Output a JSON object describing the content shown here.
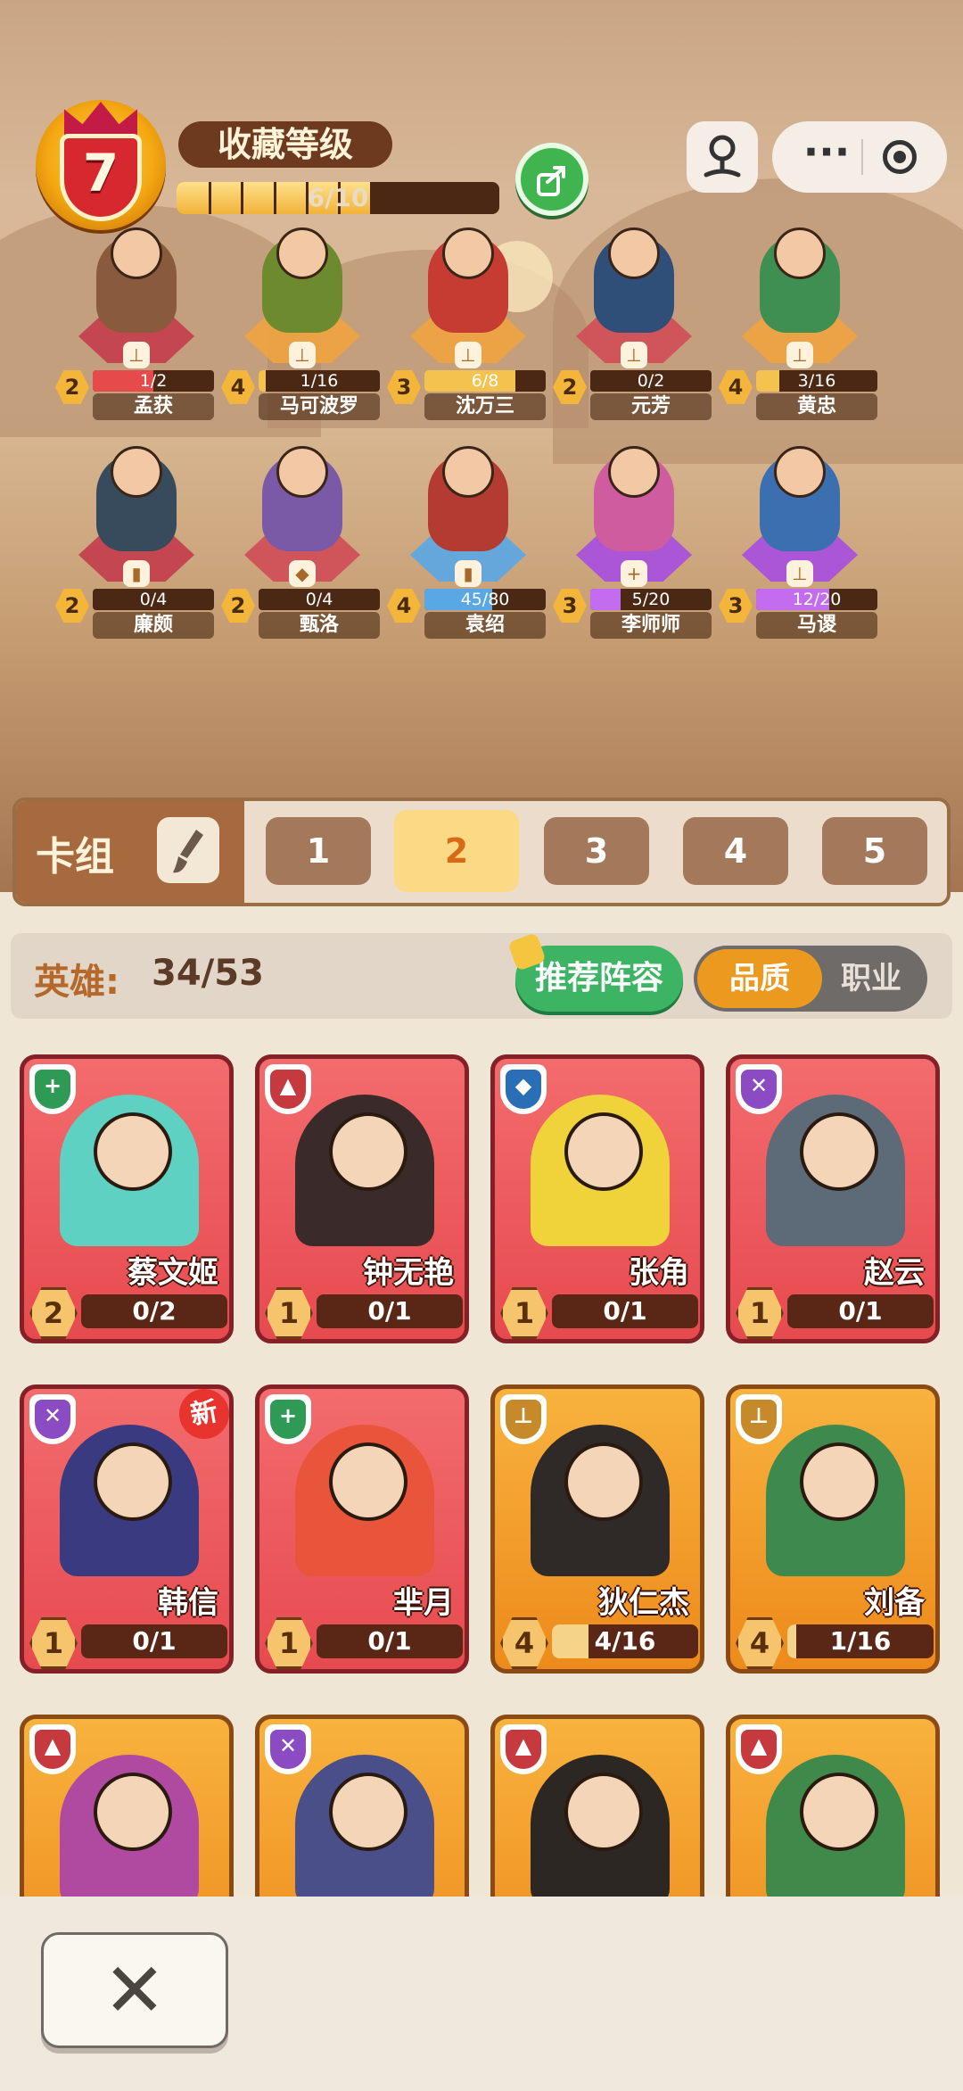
{
  "collection": {
    "level": "7",
    "title": "收藏等级",
    "progress_text": "6/10",
    "progress_fraction": 0.6
  },
  "roster": [
    {
      "name": "孟获",
      "level": "2",
      "progress": "1/2",
      "fraction": 0.5,
      "color": "#8a5a3c",
      "pedestal": "#c33c4d",
      "bar": "#e74a4a",
      "class_icon": "bow-icon"
    },
    {
      "name": "马可波罗",
      "level": "4",
      "progress": "1/16",
      "fraction": 0.06,
      "color": "#6d8a2e",
      "pedestal": "#f0a340",
      "bar": "#f4c24f",
      "class_icon": "bow-icon"
    },
    {
      "name": "沈万三",
      "level": "3",
      "progress": "6/8",
      "fraction": 0.75,
      "color": "#c63c32",
      "pedestal": "#f0a340",
      "bar": "#f4c24f",
      "class_icon": "bow-icon"
    },
    {
      "name": "元芳",
      "level": "2",
      "progress": "0/2",
      "fraction": 0.0,
      "color": "#2f4e78",
      "pedestal": "#d04c57",
      "bar": "#e74a4a",
      "class_icon": "bow-icon"
    },
    {
      "name": "黄忠",
      "level": "4",
      "progress": "3/16",
      "fraction": 0.19,
      "color": "#3f8e52",
      "pedestal": "#f0a340",
      "bar": "#f4c24f",
      "class_icon": "bow-icon"
    },
    {
      "name": "廉颇",
      "level": "2",
      "progress": "0/4",
      "fraction": 0.0,
      "color": "#384b5c",
      "pedestal": "#c33c4d",
      "bar": "#e74a4a",
      "class_icon": "shield-icon"
    },
    {
      "name": "甄洛",
      "level": "2",
      "progress": "0/4",
      "fraction": 0.0,
      "color": "#7a5aa6",
      "pedestal": "#d04c57",
      "bar": "#e74a4a",
      "class_icon": "mage-icon"
    },
    {
      "name": "袁绍",
      "level": "4",
      "progress": "45/80",
      "fraction": 0.56,
      "color": "#b33b32",
      "pedestal": "#5aa7e6",
      "bar": "#5aa7e6",
      "class_icon": "shield-icon"
    },
    {
      "name": "李师师",
      "level": "3",
      "progress": "5/20",
      "fraction": 0.25,
      "color": "#d05ca0",
      "pedestal": "#a64ee0",
      "bar": "#c36cf0",
      "class_icon": "heal-icon"
    },
    {
      "name": "马谡",
      "level": "3",
      "progress": "12/20",
      "fraction": 0.6,
      "color": "#3c6fb0",
      "pedestal": "#a64ee0",
      "bar": "#c36cf0",
      "class_icon": "bow-icon"
    }
  ],
  "deck": {
    "label": "卡组",
    "tabs": [
      "1",
      "2",
      "3",
      "4",
      "5"
    ],
    "active": "2"
  },
  "filter": {
    "hero_label": "英雄:",
    "hero_count": "34/53",
    "recommend": "推荐阵容",
    "sort_quality": "品质",
    "sort_class": "职业"
  },
  "cards": [
    {
      "name": "蔡文姬",
      "level": "2",
      "progress": "0/2",
      "fraction": 0.0,
      "style": "red",
      "badge_color": "#2f9a55",
      "glyph": "+",
      "class_icon": "heal-icon",
      "tint": "#5fd1c2",
      "new": false
    },
    {
      "name": "钟无艳",
      "level": "1",
      "progress": "0/1",
      "fraction": 0.0,
      "style": "red",
      "badge_color": "#c63a3f",
      "glyph": "▲",
      "class_icon": "sword-icon",
      "tint": "#3a2a2a",
      "new": false
    },
    {
      "name": "张角",
      "level": "1",
      "progress": "0/1",
      "fraction": 0.0,
      "style": "red",
      "badge_color": "#2a6fb6",
      "glyph": "◆",
      "class_icon": "mage-icon",
      "tint": "#f0d23a",
      "new": false
    },
    {
      "name": "赵云",
      "level": "1",
      "progress": "0/1",
      "fraction": 0.0,
      "style": "red",
      "badge_color": "#8b4bc2",
      "glyph": "✕",
      "class_icon": "assassin-icon",
      "tint": "#5d6a78",
      "new": false
    },
    {
      "name": "韩信",
      "level": "1",
      "progress": "0/1",
      "fraction": 0.0,
      "style": "red",
      "badge_color": "#8b4bc2",
      "glyph": "✕",
      "class_icon": "assassin-icon",
      "tint": "#3a3a80",
      "new": true
    },
    {
      "name": "芈月",
      "level": "1",
      "progress": "0/1",
      "fraction": 0.0,
      "style": "red",
      "badge_color": "#2f9a55",
      "glyph": "+",
      "class_icon": "heal-icon",
      "tint": "#e8553a",
      "new": false
    },
    {
      "name": "狄仁杰",
      "level": "4",
      "progress": "4/16",
      "fraction": 0.25,
      "style": "gold",
      "badge_color": "#c78a2a",
      "glyph": "⊥",
      "class_icon": "bow-icon",
      "tint": "#2f2a28",
      "new": false
    },
    {
      "name": "刘备",
      "level": "4",
      "progress": "1/16",
      "fraction": 0.06,
      "style": "gold",
      "badge_color": "#c78a2a",
      "glyph": "⊥",
      "class_icon": "bow-icon",
      "tint": "#3e8a4e",
      "new": false
    },
    {
      "name": "",
      "level": "",
      "progress": "",
      "fraction": 0.0,
      "style": "gold",
      "badge_color": "#c63a3f",
      "glyph": "▲",
      "class_icon": "sword-icon",
      "tint": "#b04aa0",
      "new": false
    },
    {
      "name": "",
      "level": "",
      "progress": "",
      "fraction": 0.0,
      "style": "gold",
      "badge_color": "#8b4bc2",
      "glyph": "✕",
      "class_icon": "assassin-icon",
      "tint": "#4a4f8a",
      "new": false
    },
    {
      "name": "",
      "level": "",
      "progress": "",
      "fraction": 0.0,
      "style": "gold",
      "badge_color": "#c63a3f",
      "glyph": "▲",
      "class_icon": "sword-icon",
      "tint": "#2d2724",
      "new": false
    },
    {
      "name": "",
      "level": "",
      "progress": "",
      "fraction": 0.0,
      "style": "gold",
      "badge_color": "#c63a3f",
      "glyph": "▲",
      "class_icon": "sword-icon",
      "tint": "#3f8a4a",
      "new": false
    }
  ],
  "close": {
    "label": "✕"
  }
}
